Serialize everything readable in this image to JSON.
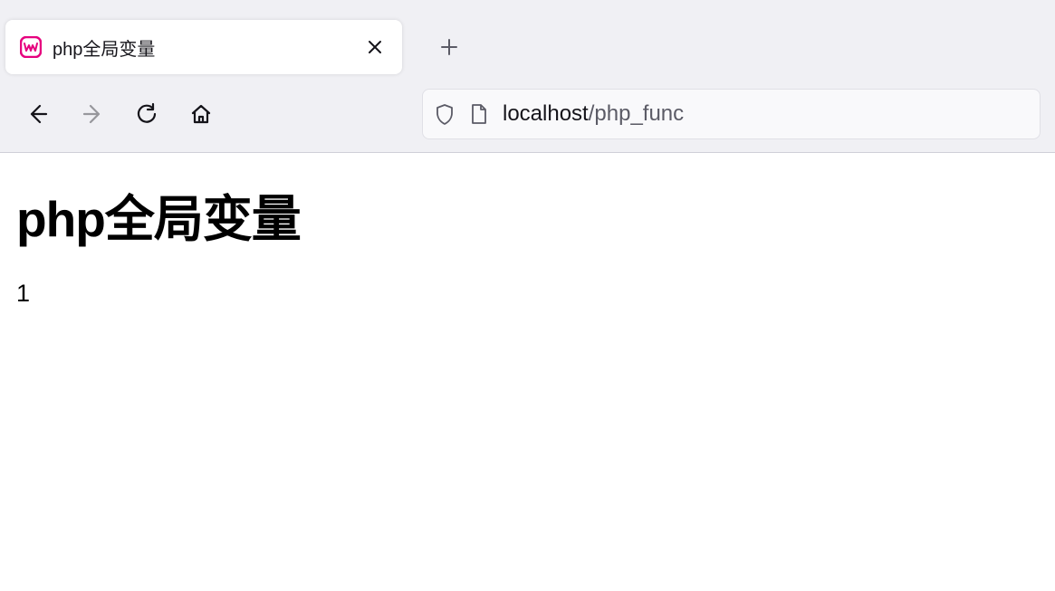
{
  "browser": {
    "tab": {
      "title": "php全局变量"
    },
    "url": {
      "host": "localhost",
      "path": "/php_func"
    }
  },
  "page": {
    "heading": "php全局变量",
    "body_text": "1"
  }
}
